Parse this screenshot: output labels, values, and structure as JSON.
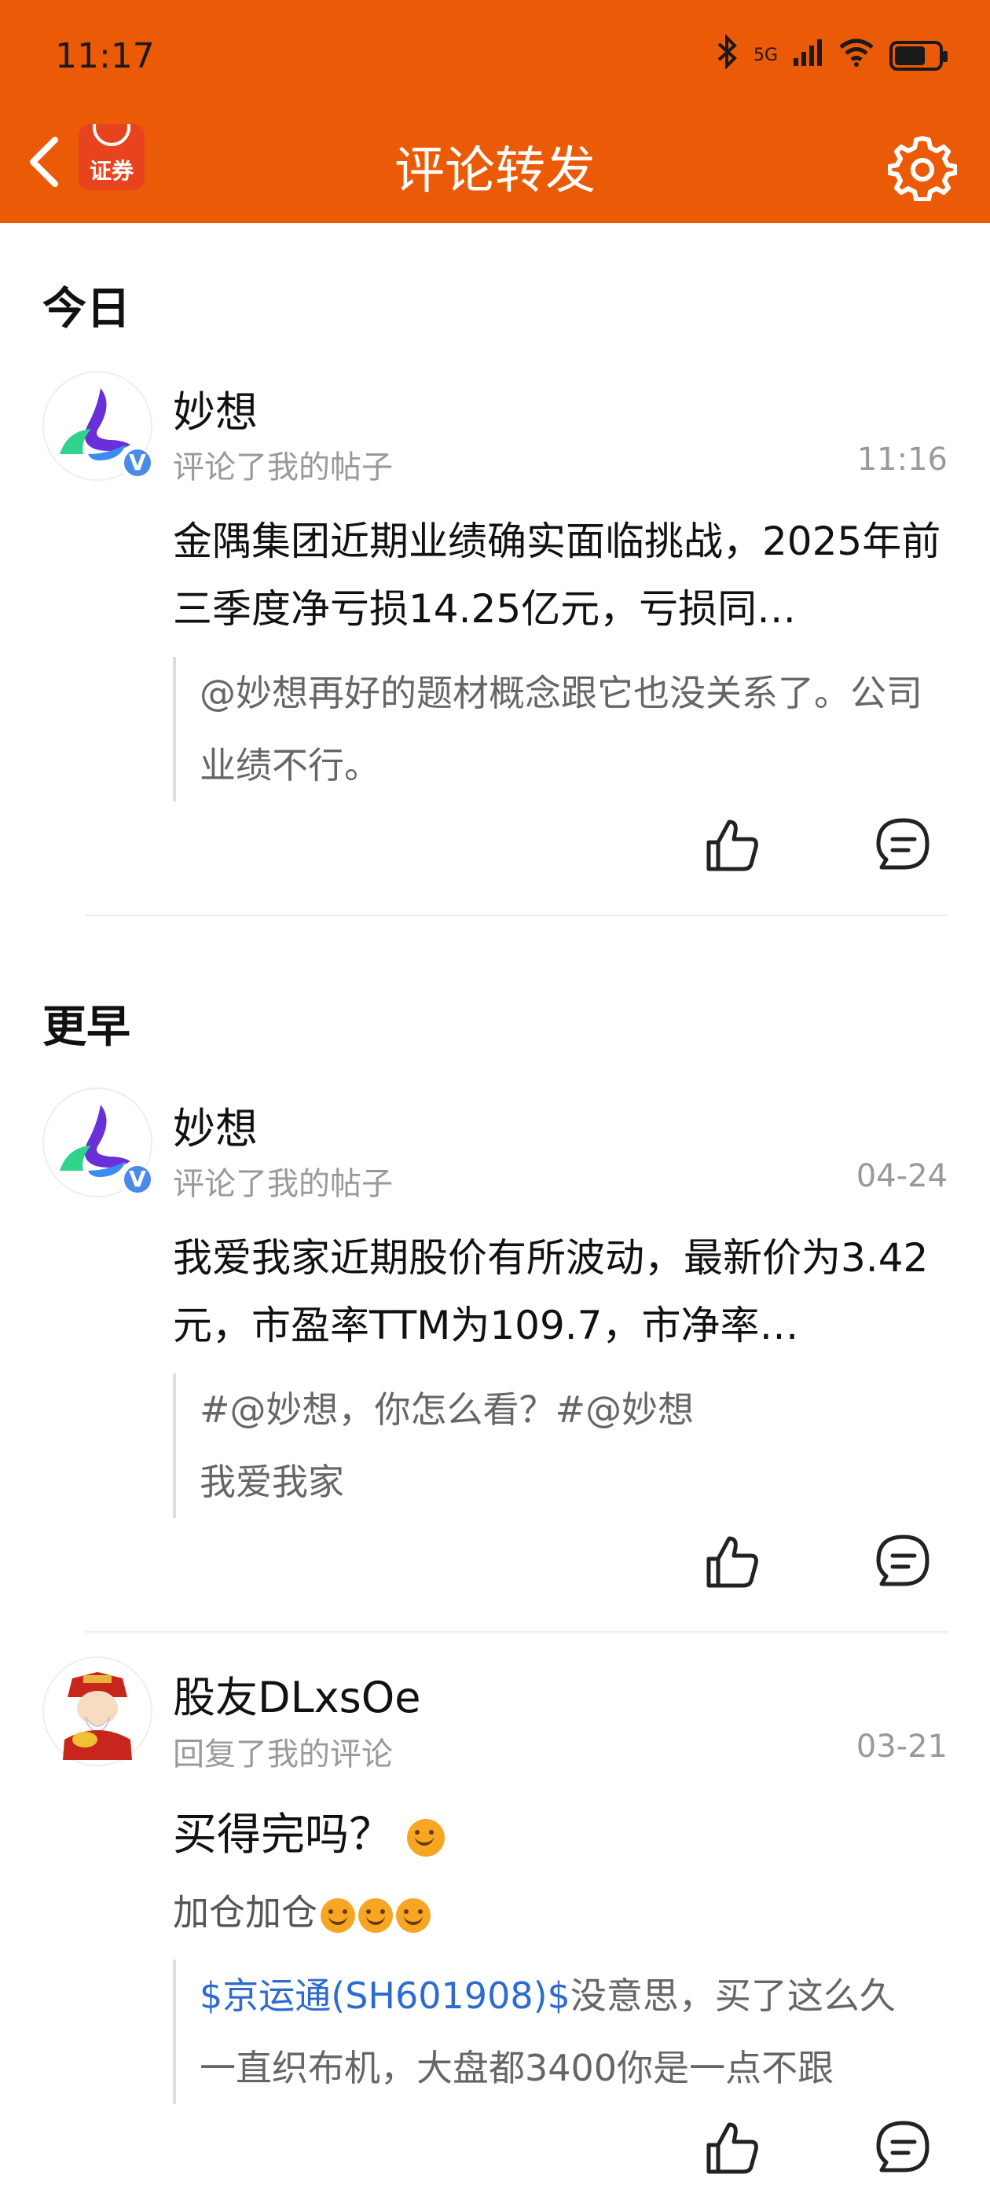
{
  "status_bar": {
    "time": "11:17",
    "network": "5G"
  },
  "header": {
    "title": "评论转发",
    "logo_text": "证券",
    "accent_color": "#EB5A06"
  },
  "sections": [
    {
      "title": "今日"
    },
    {
      "title": "更早"
    }
  ],
  "items": [
    {
      "username": "妙想",
      "action": "评论了我的帖子",
      "time": "11:16",
      "content": "金隅集团近期业绩确实面临挑战，2025年前三季度净亏损14.25亿元，亏损同…",
      "quote": "@妙想再好的题材概念跟它也没关系了。公司业绩不行。"
    },
    {
      "username": "妙想",
      "action": "评论了我的帖子",
      "time": "04-24",
      "content": "我爱我家近期股价有所波动，最新价为3.42元，市盈率TTM为109.7，市净率…",
      "quote_line1": "#@妙想，你怎么看？#@妙想",
      "quote_line2": "我爱我家"
    },
    {
      "username": "股友DLxsOe",
      "action": "回复了我的评论",
      "time": "03-21",
      "content": "买得完吗？",
      "sub": "加仓加仓",
      "quote_link": "$京运通(SH601908)$",
      "quote_text": "没意思，买了这么久",
      "quote_line2": "一直织布机，大盘都3400你是一点不跟"
    }
  ],
  "icons": {
    "back": "back-arrow-icon",
    "settings": "gear-icon",
    "like": "thumbs-up-icon",
    "comment": "comment-icon",
    "verified": "verified-badge-icon"
  },
  "verified_badge": "V"
}
